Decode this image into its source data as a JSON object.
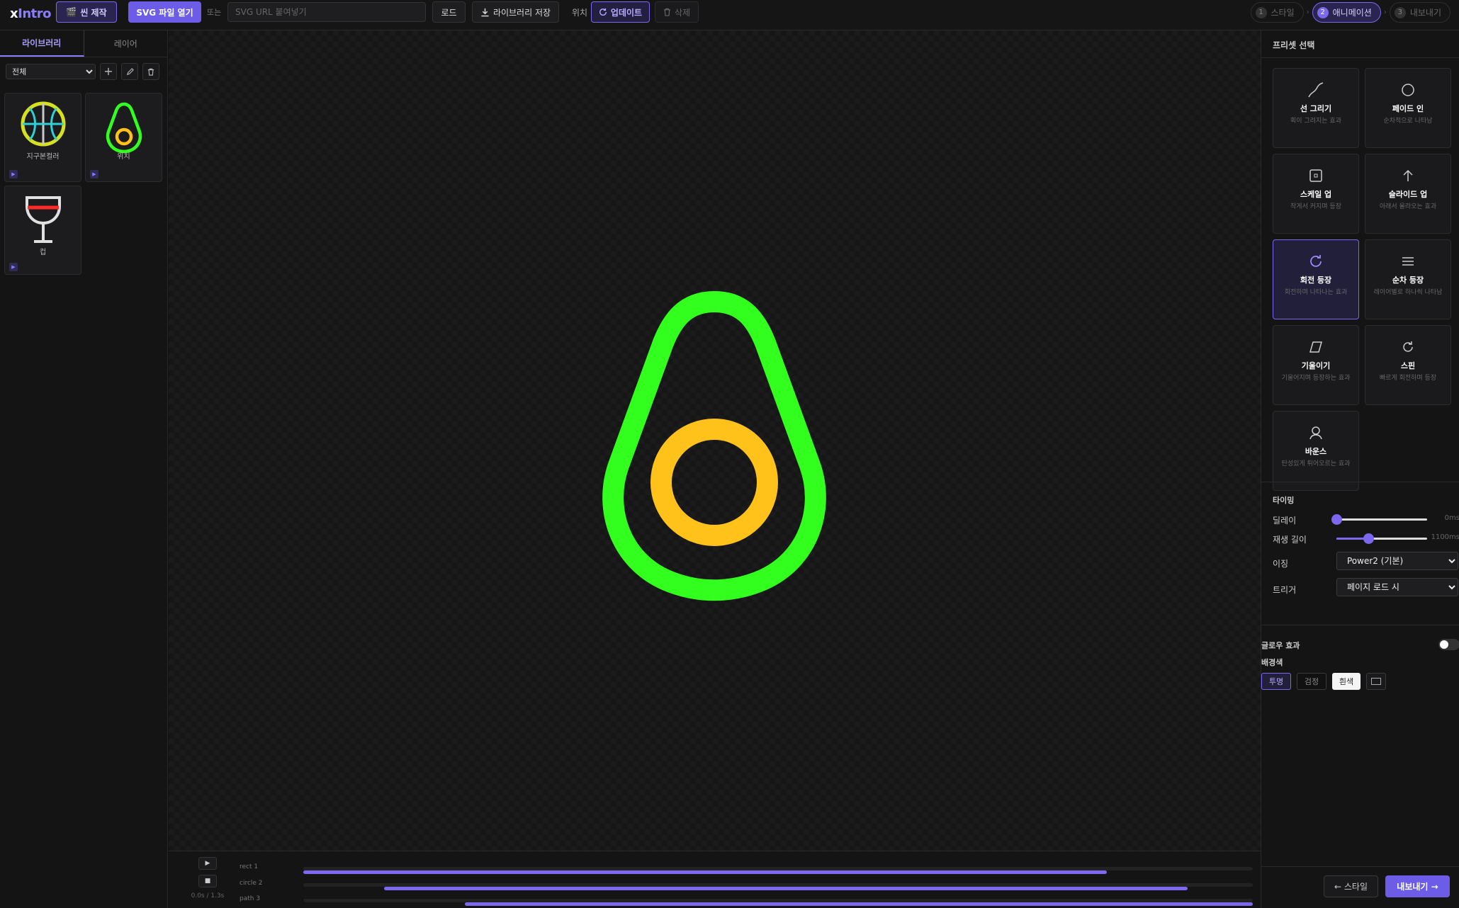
{
  "app": {
    "logo_main": "x",
    "logo_accent": "Intro"
  },
  "toolbar": {
    "scene_label": "씬 제작",
    "open_label": "SVG 파일 열기",
    "or_label": "또는",
    "url_placeholder": "SVG URL 붙여넣기",
    "load_label": "로드",
    "save_lib_label": "라이브러리 저장",
    "position_label": "위치",
    "update_label": "업데이트",
    "delete_label": "삭제"
  },
  "steps": [
    {
      "num": "1",
      "label": "스타일"
    },
    {
      "num": "2",
      "label": "애니메이션"
    },
    {
      "num": "3",
      "label": "내보내기"
    }
  ],
  "left": {
    "tabs": [
      "라이브러리",
      "레이어"
    ],
    "category": "전체",
    "items": [
      {
        "name": "지구본컬러",
        "icon": "basketball-globe-icon"
      },
      {
        "name": "위치",
        "icon": "avocado-pin-icon"
      },
      {
        "name": "컵",
        "icon": "wine-glass-icon"
      }
    ]
  },
  "canvas": {
    "colors": {
      "outer": "#33ff1f",
      "inner": "#ffc21a"
    }
  },
  "timeline": {
    "time": "0.0s / 1.3s",
    "tracks": [
      {
        "name": "rect 1",
        "start": 0.0,
        "end": 0.846
      },
      {
        "name": "circle 2",
        "start": 0.085,
        "end": 0.931
      },
      {
        "name": "path 3",
        "start": 0.17,
        "end": 1.0
      }
    ]
  },
  "right": {
    "preset_title": "프리셋 선택",
    "presets": [
      {
        "name": "선 그리기",
        "desc": "획이 그려지는 효과",
        "icon": "curve-icon"
      },
      {
        "name": "페이드 인",
        "desc": "순차적으로 나타남",
        "icon": "circle-icon"
      },
      {
        "name": "스케일 업",
        "desc": "작게서 커지며 등장",
        "icon": "square-icon"
      },
      {
        "name": "슬라이드 업",
        "desc": "아래서 올라오는 효과",
        "icon": "arrow-up-icon"
      },
      {
        "name": "회전 등장",
        "desc": "회전하며 나타나는 효과",
        "icon": "rotate-icon"
      },
      {
        "name": "순차 등장",
        "desc": "레이어별로 하나씩 나타남",
        "icon": "lines-icon"
      },
      {
        "name": "기울이기",
        "desc": "기울어지며 등장하는 효과",
        "icon": "skew-icon"
      },
      {
        "name": "스핀",
        "desc": "빠르게 회전하며 등장",
        "icon": "spin-icon"
      },
      {
        "name": "바운스",
        "desc": "탄성있게 튀어오르는 효과",
        "icon": "person-icon"
      }
    ],
    "timing_title": "타이밍",
    "delay_label": "딜레이",
    "delay_value": "0ms",
    "delay_fraction": 0.0,
    "duration_label": "재생 길이",
    "duration_value": "1100ms",
    "duration_fraction": 0.35,
    "easing_label": "이징",
    "easing_value": "Power2 (기본)",
    "trigger_label": "트리거",
    "trigger_value": "페이지 로드 시",
    "glow_label": "글로우 효과",
    "bg_title": "배경색",
    "bg_options": [
      "투명",
      "검정",
      "흰색"
    ],
    "prev_label": "← 스타일",
    "export_label": "내보내기 →"
  }
}
